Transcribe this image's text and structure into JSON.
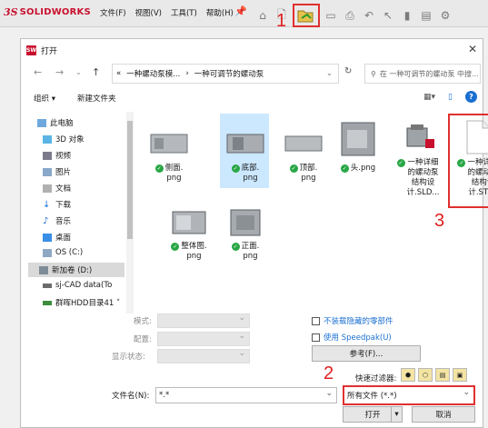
{
  "app": {
    "logo_ds": "3S",
    "logo_name": "SOLIDWORKS",
    "menu": [
      "文件(F)",
      "视图(V)",
      "工具(T)",
      "帮助(H)"
    ]
  },
  "annotations": {
    "one": "1",
    "two": "2",
    "three": "3"
  },
  "dialog": {
    "title": "打开",
    "app_icon_text": "SW",
    "breadcrumb": [
      "«",
      "一种螺动泵模...",
      "一种可调节的螺动泵"
    ],
    "search_placeholder": "在 一种可调节的螺动泵 中搜...",
    "organize": "组织 ▾",
    "new_folder": "新建文件夹"
  },
  "sidebar": {
    "items": [
      {
        "label": "此电脑",
        "icon": "pc-icon"
      },
      {
        "label": "3D 对象",
        "icon": "cube-icon"
      },
      {
        "label": "视频",
        "icon": "video-icon"
      },
      {
        "label": "图片",
        "icon": "picture-icon"
      },
      {
        "label": "文档",
        "icon": "document-icon"
      },
      {
        "label": "下载",
        "icon": "download-icon"
      },
      {
        "label": "音乐",
        "icon": "music-icon"
      },
      {
        "label": "桌面",
        "icon": "desktop-icon"
      },
      {
        "label": "OS (C:)",
        "icon": "drive-icon"
      },
      {
        "label": "新加卷 (D:)",
        "icon": "drive-icon"
      },
      {
        "label": "sj-CAD data(To",
        "icon": "network-drive-icon"
      },
      {
        "label": "群晖HDD目录41 ˅",
        "icon": "network-drive-icon"
      }
    ]
  },
  "files": [
    {
      "name": "侧面.\npng"
    },
    {
      "name": "底部.\npng"
    },
    {
      "name": "顶部.\npng"
    },
    {
      "name": "头.png"
    },
    {
      "name": "一种详细\n的螺动泵\n结构设\n计.SLD..."
    },
    {
      "name": "一种详细\n的螺动泵\n结构设\n计.STEP"
    },
    {
      "name": "整体图.\npng"
    },
    {
      "name": "正面.\npng"
    }
  ],
  "form": {
    "mode_label": "模式:",
    "config_label": "配置:",
    "display_label": "显示状态:",
    "cb_hidden": "不装载隐藏的零部件",
    "cb_speedpak": "使用 Speedpak(U)",
    "reference_button": "参考(F)...",
    "quick_filter": "快速过滤器:",
    "filename_label": "文件名(N):",
    "filename_value": "*.*",
    "filetype_value": "所有文件 (*.*)",
    "open_button": "打开",
    "cancel_button": "取消"
  }
}
